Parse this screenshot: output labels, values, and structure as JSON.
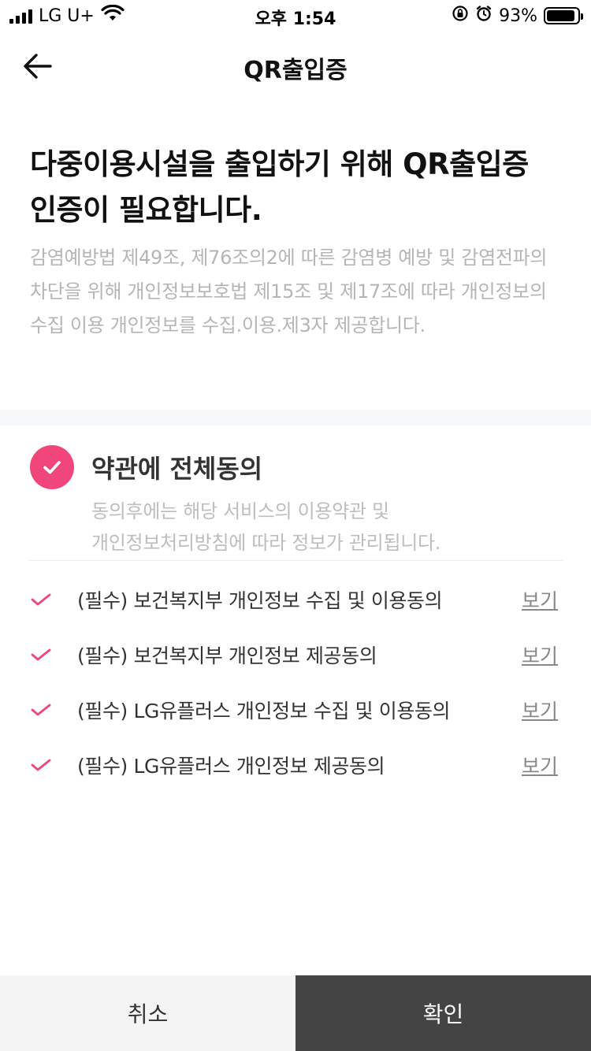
{
  "status_bar": {
    "carrier": "LG U+",
    "time": "오후 1:54",
    "battery": "93%",
    "battery_level": 0.93,
    "icons": [
      "signal-icon",
      "wifi-icon",
      "rotation-lock-icon",
      "alarm-icon",
      "battery-icon"
    ]
  },
  "nav": {
    "title": "QR출입증",
    "back_icon": "back-arrow-icon"
  },
  "intro": {
    "headline_line1": "다중이용시설을 출입하기 위해 QR출입증",
    "headline_line2": "인증이 필요합니다.",
    "description": "감염예방법 제49조, 제76조의2에 따른 감염병 예방 및 감염전파의 차단을 위해 개인정보보호법 제15조 및 제17조에 따라 개인정보의 수집 이용 개인정보를 수집.이용.제3자 제공합니다."
  },
  "all_agree": {
    "label": "약관에 전체동의",
    "sub_line1": "동의후에는 해당 서비스의 이용약관 및",
    "sub_line2": "개인정보처리방침에 따라 정보가 관리됩니다.",
    "checked": true
  },
  "terms": [
    {
      "label": "(필수) 보건복지부 개인정보 수집 및 이용동의",
      "link": "보기",
      "checked": true
    },
    {
      "label": "(필수) 보건복지부 개인정보 제공동의",
      "link": "보기",
      "checked": true
    },
    {
      "label": "(필수) LG유플러스 개인정보 수집 및 이용동의",
      "link": "보기",
      "checked": true
    },
    {
      "label": "(필수) LG유플러스 개인정보 제공동의",
      "link": "보기",
      "checked": true
    }
  ],
  "buttons": {
    "cancel": "취소",
    "confirm": "확인"
  },
  "colors": {
    "accent": "#f0467c",
    "confirm_bg": "#444444",
    "cancel_bg": "#f4f4f4"
  }
}
